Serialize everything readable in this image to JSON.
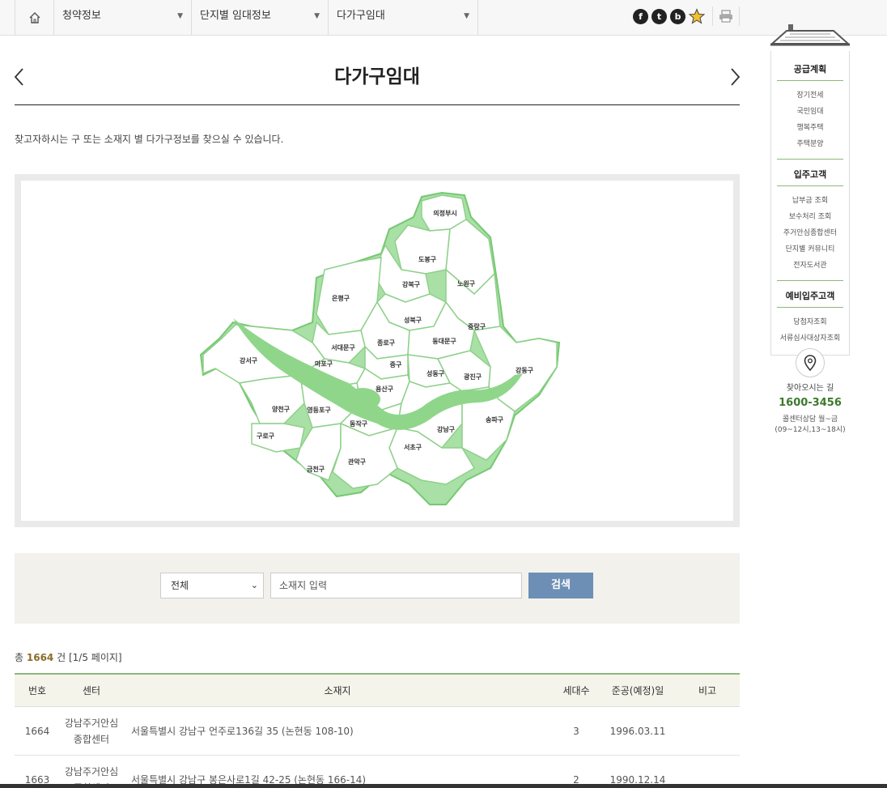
{
  "nav": {
    "home_icon": "home-icon",
    "menu1": "청약정보",
    "menu2": "단지별 임대정보",
    "menu3": "다가구임대",
    "sns": [
      "f",
      "t",
      "b"
    ]
  },
  "page": {
    "title": "다가구임대",
    "description": "찾고자하시는 구 또는 소재지 별 다가구정보를 찾으실 수 있습니다."
  },
  "map": {
    "districts": [
      "의정부시",
      "도봉구",
      "노원구",
      "강북구",
      "은평구",
      "성북구",
      "중랑구",
      "종로구",
      "동대문구",
      "서대문구",
      "강서구",
      "마포구",
      "중구",
      "성동구",
      "광진구",
      "강동구",
      "용산구",
      "양천구",
      "영등포구",
      "동작구",
      "강남구",
      "송파구",
      "구로구",
      "서초구",
      "금천구",
      "관악구"
    ]
  },
  "search": {
    "select_value": "전체",
    "input_placeholder": "소재지 입력",
    "button_label": "검색"
  },
  "result": {
    "prefix": "총",
    "total": "1664",
    "suffix": "건 [1/5 페이지]"
  },
  "table": {
    "headers": [
      "번호",
      "센터",
      "소재지",
      "세대수",
      "준공(예정)일",
      "비고"
    ],
    "rows": [
      {
        "no": "1664",
        "center_line1": "강남주거안심",
        "center_line2": "종합센터",
        "address": "서울특별시 강남구 언주로136길 35  (논현동 108-10)",
        "units": "3",
        "date": "1996.03.11",
        "note": ""
      },
      {
        "no": "1663",
        "center_line1": "강남주거안심",
        "center_line2": "종합센터",
        "address": "서울특별시 강남구 봉은사로1길 42-25  (논현동 166-14)",
        "units": "2",
        "date": "1990.12.14",
        "note": ""
      }
    ]
  },
  "sidebar": {
    "section1": "공급계획",
    "section1_items": [
      "장기전세",
      "국민임대",
      "행복주택",
      "주택분양"
    ],
    "section2": "입주고객",
    "section2_items": [
      "납부금 조회",
      "보수처리 조회",
      "주거안심종합센터",
      "단지별 커뮤니티",
      "전자도서관"
    ],
    "section3": "예비입주고객",
    "section3_items": [
      "당첨자조회",
      "서류심사대상자조회"
    ],
    "location_label": "찾아오시는 길",
    "phone": "1600-3456",
    "hours_line1": "콜센터상담 월~금",
    "hours_line2": "(09~12시,13~18시)"
  },
  "colors": {
    "map_fill": "#a9e0a6",
    "map_stroke": "#6ac366",
    "river": "#8fd68b",
    "search_button": "#6e8fb5",
    "accent_green": "#8fb77c"
  }
}
